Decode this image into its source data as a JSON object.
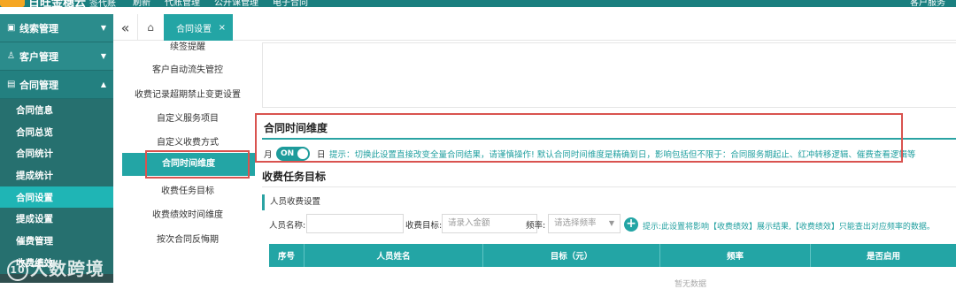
{
  "topbar": {
    "brand": "日旺金穗云",
    "brand_sub": "签代账",
    "logo": "Sansui",
    "tools": [
      "刷新",
      "代账管理",
      "公开课管理",
      "电子合同"
    ],
    "user": "客户服务"
  },
  "sidebar": {
    "groups": [
      {
        "label": "线索管理",
        "icon": "briefcase-icon"
      },
      {
        "label": "客户管理",
        "icon": "person-icon"
      },
      {
        "label": "合同管理",
        "icon": "document-icon"
      }
    ],
    "items": [
      "合同信息",
      "合同总览",
      "合同统计",
      "提成统计",
      "合同设置",
      "提成设置",
      "催费管理",
      "收费绩效"
    ],
    "active_index": 4
  },
  "tabbar": {
    "collapse_glyph": "«",
    "home_glyph": "⌂",
    "active_tab": "合同设置",
    "close_glyph": "×"
  },
  "subnav": {
    "items": [
      "续签提醒",
      "客户自动流失管控",
      "收费记录超期禁止变更设置",
      "自定义服务项目",
      "自定义收费方式",
      "合同时间维度",
      "收费任务目标",
      "收费绩效时间维度",
      "按次合同反悔期"
    ],
    "active_index": 5
  },
  "contract_time": {
    "title": "合同时间维度",
    "left_label": "月",
    "toggle_label": "ON",
    "right_label": "日",
    "tip": "提示：切换此设置直接改变全量合同结果，请谨慎操作! 默认合同时间维度是精确到日，影响包括但不限于：合同服务期起止、红冲转移逻辑、催费查看逻辑等"
  },
  "fee_target": {
    "title": "收费任务目标",
    "panel_title": "人员收费设置",
    "name_label": "人员名称:",
    "name_value": "",
    "target_label": "收费目标:",
    "target_placeholder": "请录入金额",
    "freq_label": "频率:",
    "freq_placeholder": "请选择频率",
    "add_glyph": "+",
    "tip": "提示:此设置将影响【收费绩效】展示结果,【收费绩效】只能查出对应频率的数据。",
    "columns": [
      "序号",
      "人员姓名",
      "目标（元）",
      "频率",
      "是否启用"
    ],
    "empty_text": "暂无数据"
  },
  "watermark": {
    "badge": "10",
    "text": "大数跨境"
  },
  "colors": {
    "teal": "#23a5a5",
    "sidebar_dark": "#2f4f4f",
    "highlight_red": "#d9534f"
  }
}
